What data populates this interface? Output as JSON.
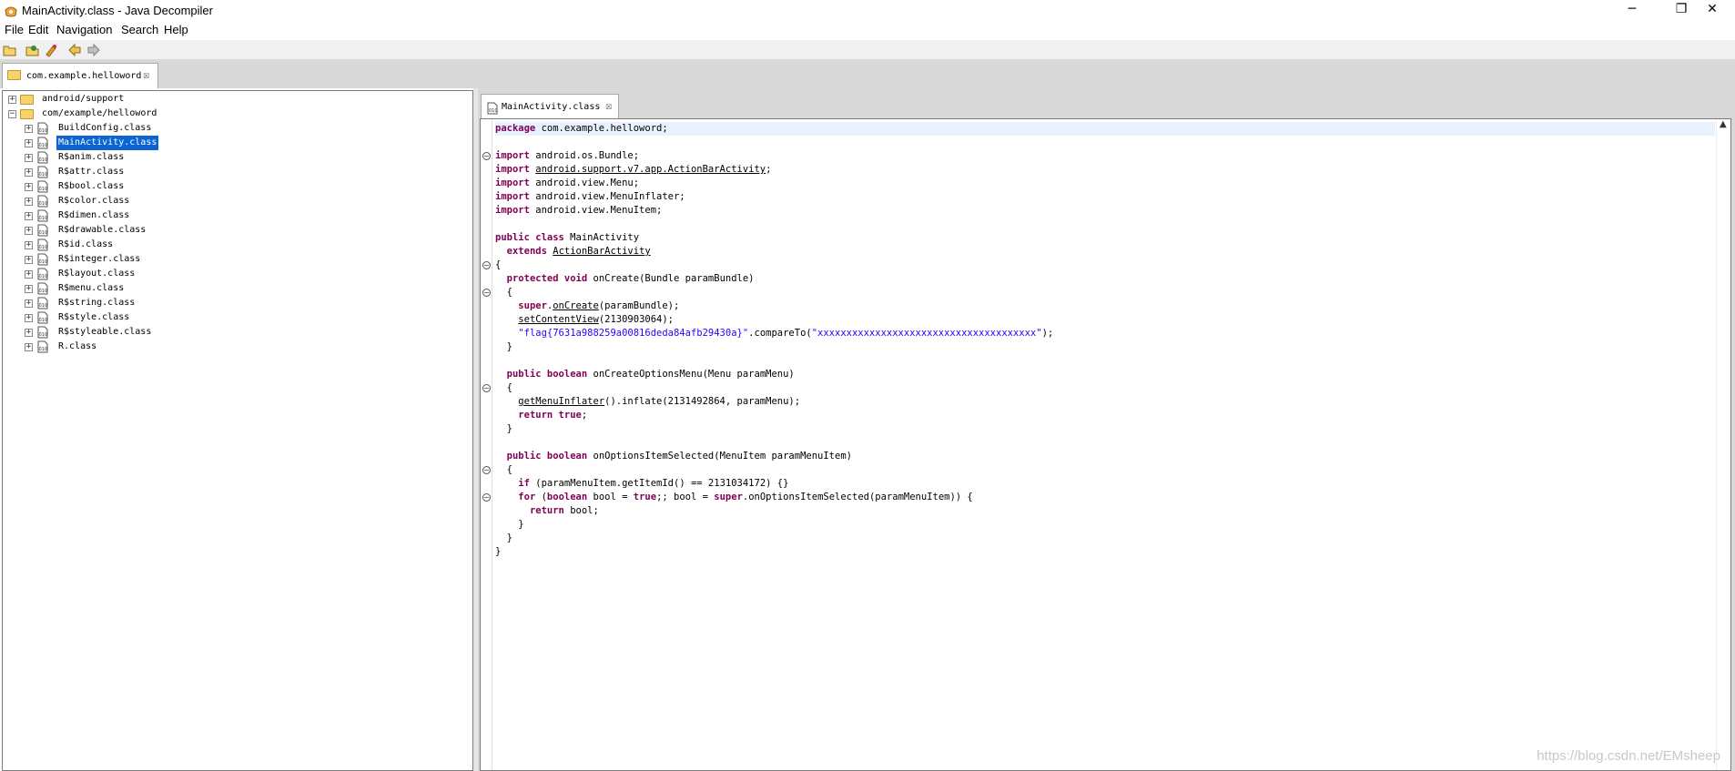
{
  "window": {
    "title": "MainActivity.class - Java Decompiler",
    "minimize": "─",
    "restore": "❐",
    "close": "✕"
  },
  "menu": [
    "File",
    "Edit",
    "Navigation",
    "Search",
    "Help"
  ],
  "toolbar": [
    "open-file-icon",
    "open-type-icon",
    "search-icon",
    "back-arrow-icon",
    "forward-arrow-icon"
  ],
  "archive_tab": {
    "label": "com.example.helloword",
    "close": "☒"
  },
  "tree": [
    {
      "label": "android/support",
      "type": "folder",
      "depth": 0,
      "expander": "+"
    },
    {
      "label": "com/example/helloword",
      "type": "folder-open",
      "depth": 0,
      "expander": "−"
    },
    {
      "label": "BuildConfig.class",
      "type": "class",
      "depth": 1,
      "expander": "+"
    },
    {
      "label": "MainActivity.class",
      "type": "class",
      "depth": 1,
      "expander": "+",
      "selected": true
    },
    {
      "label": "R$anim.class",
      "type": "class",
      "depth": 1,
      "expander": "+"
    },
    {
      "label": "R$attr.class",
      "type": "class",
      "depth": 1,
      "expander": "+"
    },
    {
      "label": "R$bool.class",
      "type": "class",
      "depth": 1,
      "expander": "+"
    },
    {
      "label": "R$color.class",
      "type": "class",
      "depth": 1,
      "expander": "+"
    },
    {
      "label": "R$dimen.class",
      "type": "class",
      "depth": 1,
      "expander": "+"
    },
    {
      "label": "R$drawable.class",
      "type": "class",
      "depth": 1,
      "expander": "+"
    },
    {
      "label": "R$id.class",
      "type": "class",
      "depth": 1,
      "expander": "+"
    },
    {
      "label": "R$integer.class",
      "type": "class",
      "depth": 1,
      "expander": "+"
    },
    {
      "label": "R$layout.class",
      "type": "class",
      "depth": 1,
      "expander": "+"
    },
    {
      "label": "R$menu.class",
      "type": "class",
      "depth": 1,
      "expander": "+"
    },
    {
      "label": "R$string.class",
      "type": "class",
      "depth": 1,
      "expander": "+"
    },
    {
      "label": "R$style.class",
      "type": "class",
      "depth": 1,
      "expander": "+"
    },
    {
      "label": "R$styleable.class",
      "type": "class",
      "depth": 1,
      "expander": "+"
    },
    {
      "label": "R.class",
      "type": "class",
      "depth": 1,
      "expander": "+"
    }
  ],
  "editor_tab": {
    "label": "MainActivity.class",
    "close": "☒"
  },
  "code": [
    [
      [
        "kw",
        "package"
      ],
      [
        "t",
        " com.example.helloword;"
      ]
    ],
    [],
    [
      [
        "kw",
        "import"
      ],
      [
        "t",
        " android.os.Bundle;"
      ]
    ],
    [
      [
        "kw",
        "import"
      ],
      [
        "t",
        " "
      ],
      [
        "u",
        "android.support.v7.app.ActionBarActivity"
      ],
      [
        "t",
        ";"
      ]
    ],
    [
      [
        "kw",
        "import"
      ],
      [
        "t",
        " android.view.Menu;"
      ]
    ],
    [
      [
        "kw",
        "import"
      ],
      [
        "t",
        " android.view.MenuInflater;"
      ]
    ],
    [
      [
        "kw",
        "import"
      ],
      [
        "t",
        " android.view.MenuItem;"
      ]
    ],
    [],
    [
      [
        "kw",
        "public class"
      ],
      [
        "t",
        " MainActivity"
      ]
    ],
    [
      [
        "t",
        "  "
      ],
      [
        "kw",
        "extends"
      ],
      [
        "t",
        " "
      ],
      [
        "u",
        "ActionBarActivity"
      ]
    ],
    [
      [
        "t",
        "{"
      ]
    ],
    [
      [
        "t",
        "  "
      ],
      [
        "kw",
        "protected void"
      ],
      [
        "t",
        " onCreate(Bundle paramBundle)"
      ]
    ],
    [
      [
        "t",
        "  {"
      ]
    ],
    [
      [
        "t",
        "    "
      ],
      [
        "kw",
        "super"
      ],
      [
        "t",
        "."
      ],
      [
        "u",
        "onCreate"
      ],
      [
        "t",
        "(paramBundle);"
      ]
    ],
    [
      [
        "t",
        "    "
      ],
      [
        "u",
        "setContentView"
      ],
      [
        "t",
        "(2130903064);"
      ]
    ],
    [
      [
        "t",
        "    "
      ],
      [
        "str",
        "\"flag{7631a988259a00816deda84afb29430a}\""
      ],
      [
        "t",
        ".compareTo("
      ],
      [
        "str",
        "\"xxxxxxxxxxxxxxxxxxxxxxxxxxxxxxxxxxxxxx\""
      ],
      [
        "t",
        ");"
      ]
    ],
    [
      [
        "t",
        "  }"
      ]
    ],
    [],
    [
      [
        "t",
        "  "
      ],
      [
        "kw",
        "public boolean"
      ],
      [
        "t",
        " onCreateOptionsMenu(Menu paramMenu)"
      ]
    ],
    [
      [
        "t",
        "  {"
      ]
    ],
    [
      [
        "t",
        "    "
      ],
      [
        "u",
        "getMenuInflater"
      ],
      [
        "t",
        "().inflate(2131492864, paramMenu);"
      ]
    ],
    [
      [
        "t",
        "    "
      ],
      [
        "kw",
        "return true"
      ],
      [
        "t",
        ";"
      ]
    ],
    [
      [
        "t",
        "  }"
      ]
    ],
    [],
    [
      [
        "t",
        "  "
      ],
      [
        "kw",
        "public boolean"
      ],
      [
        "t",
        " onOptionsItemSelected(MenuItem paramMenuItem)"
      ]
    ],
    [
      [
        "t",
        "  {"
      ]
    ],
    [
      [
        "t",
        "    "
      ],
      [
        "kw",
        "if"
      ],
      [
        "t",
        " (paramMenuItem.getItemId() == 2131034172) {}"
      ]
    ],
    [
      [
        "t",
        "    "
      ],
      [
        "kw",
        "for"
      ],
      [
        "t",
        " ("
      ],
      [
        "kw",
        "boolean"
      ],
      [
        "t",
        " bool = "
      ],
      [
        "kw",
        "true"
      ],
      [
        "t",
        ";; bool = "
      ],
      [
        "kw",
        "super"
      ],
      [
        "t",
        ".onOptionsItemSelected(paramMenuItem)) {"
      ]
    ],
    [
      [
        "t",
        "      "
      ],
      [
        "kw",
        "return"
      ],
      [
        "t",
        " bool;"
      ]
    ],
    [
      [
        "t",
        "    }"
      ]
    ],
    [
      [
        "t",
        "  }"
      ]
    ],
    [
      [
        "t",
        "}"
      ]
    ]
  ],
  "fold_markers": [
    2,
    10,
    12,
    19,
    25,
    27
  ],
  "fold_glyph": "⊖",
  "scroll_up": "▲",
  "watermark": "https://blog.csdn.net/EMsheep"
}
